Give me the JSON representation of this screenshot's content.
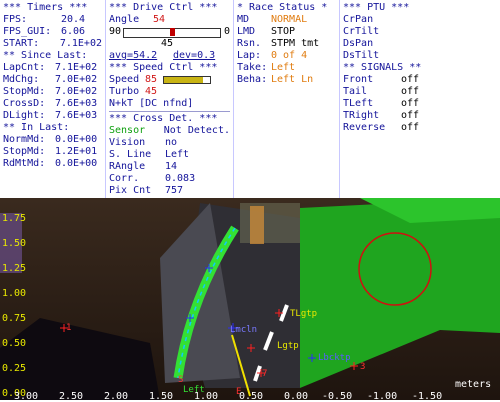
{
  "timers": {
    "header": "*** Timers ***",
    "rows": [
      {
        "k": "FPS:",
        "v": "20.4"
      },
      {
        "k": "FPS_GUI:",
        "v": "6.06"
      },
      {
        "k": "START:",
        "v": "7.1E+02"
      }
    ],
    "since_header": "** Since Last:",
    "since": [
      {
        "k": "LapCnt:",
        "v": "7.1E+02"
      },
      {
        "k": "MdChg:",
        "v": "7.0E+02"
      },
      {
        "k": "StopMd:",
        "v": "7.0E+02"
      },
      {
        "k": "CrossD:",
        "v": "7.6E+03"
      },
      {
        "k": "DLight:",
        "v": "7.6E+03"
      }
    ],
    "inlast_header": "** In Last:",
    "inlast": [
      {
        "k": "NormMd:",
        "v": "0.0E+00"
      },
      {
        "k": "StopMd:",
        "v": "1.2E+01"
      },
      {
        "k": "RdMtMd:",
        "v": "0.0E+00"
      }
    ]
  },
  "drive": {
    "header": "*** Drive Ctrl ***",
    "angle_label": "Angle",
    "angle_value": "54",
    "range_left": "90",
    "range_right": "0",
    "slider_fraction": 0.5,
    "slider_mid": "45",
    "avg": "avg=54.2",
    "dev": "dev=0.3",
    "speed_header": "*** Speed Ctrl ***",
    "speed_label": "Speed",
    "speed_value": "85",
    "speed_fraction": 0.85,
    "turbo_label": "Turbo",
    "turbo_value": "45",
    "nkt": "N+kT [DC nfnd]",
    "cross_header": "*** Cross Det. ***",
    "cross": [
      {
        "k": "Sensor",
        "v": "Not Detect."
      },
      {
        "k": "Vision",
        "v": "no"
      },
      {
        "k": "S. Line",
        "v": "Left"
      },
      {
        "k": "RAngle",
        "v": "14"
      },
      {
        "k": "Corr.",
        "v": "0.083"
      },
      {
        "k": "Pix Cnt",
        "v": "757"
      }
    ]
  },
  "race": {
    "header": "* Race Status *",
    "rows": [
      {
        "k": "MD",
        "v": "NORMAL"
      },
      {
        "k": "LMD",
        "v": "STOP"
      },
      {
        "k": "Rsn.",
        "v": "STPM tmt"
      },
      {
        "k": "Lap:",
        "v": "0 of 4"
      },
      {
        "k": "Take:",
        "v": "Left"
      },
      {
        "k": "Beha:",
        "v": "Left Ln"
      }
    ]
  },
  "ptu": {
    "header": "*** PTU ***",
    "items": [
      "CrPan",
      "CrTilt",
      "DsPan",
      "DsTilt"
    ],
    "signals_header": "** SIGNALS **",
    "signals": [
      {
        "k": "Front",
        "v": "off"
      },
      {
        "k": "Tail",
        "v": "off"
      },
      {
        "k": "TLeft",
        "v": "off"
      },
      {
        "k": "TRight",
        "v": "off"
      },
      {
        "k": "Reverse",
        "v": "off"
      }
    ]
  },
  "view": {
    "y_ticks": [
      "1.75",
      "1.50",
      "1.25",
      "1.00",
      "0.75",
      "0.50",
      "0.25",
      "0.00"
    ],
    "x_ticks": [
      "3.00",
      "2.50",
      "2.00",
      "1.50",
      "1.00",
      "0.50",
      "0.00",
      "-0.50",
      "-1.00",
      "-1.50",
      "-2.00"
    ],
    "units": "meters",
    "labels": [
      "TLgtp",
      "Lgtp",
      "Lbcktp",
      "S",
      "E",
      "Left",
      "Lmcln",
      "7",
      "1",
      "3"
    ]
  }
}
